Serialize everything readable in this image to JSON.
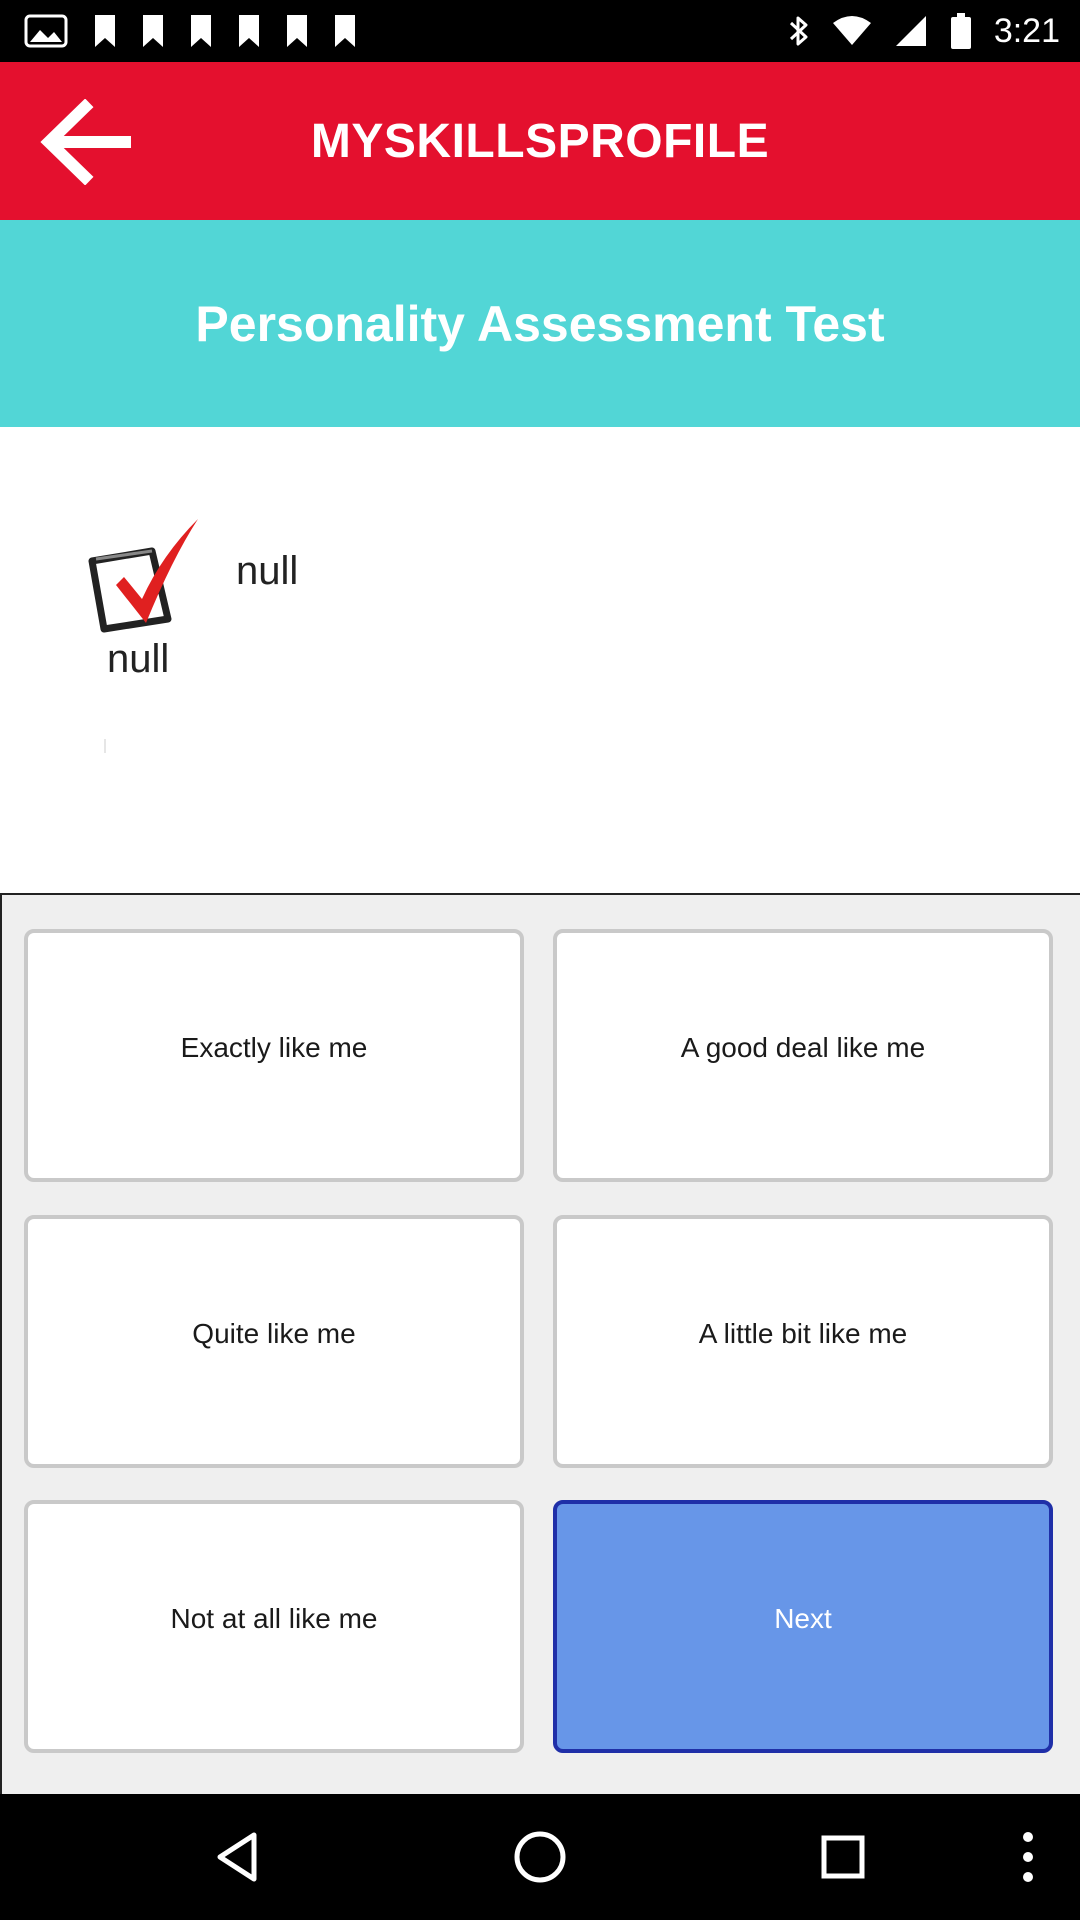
{
  "status_bar": {
    "time": "3:21",
    "notification_icons": [
      "image-icon",
      "bookmark-icon",
      "bookmark-icon",
      "bookmark-icon",
      "bookmark-icon",
      "bookmark-icon",
      "bookmark-icon"
    ],
    "system_icons": [
      "bluetooth-icon",
      "wifi-icon",
      "signal-icon",
      "battery-icon"
    ]
  },
  "app_bar": {
    "title": "MYSKILLSPROFILE",
    "back_icon": "arrow-left-icon",
    "background_color": "#e4102e"
  },
  "test_header": {
    "title": "Personality Assessment Test",
    "background_color": "#52d6d6"
  },
  "question": {
    "icon": "checkmark-icon",
    "text": "null",
    "number": "null"
  },
  "answers": {
    "options": [
      "Exactly like me",
      "A good deal like me",
      "Quite like me",
      "A little bit like me",
      "Not at all like me"
    ],
    "next_label": "Next",
    "next_color": "#6796e8"
  },
  "nav_bar": {
    "icons": [
      "back-triangle-icon",
      "home-circle-icon",
      "recents-square-icon",
      "more-vertical-icon"
    ]
  }
}
